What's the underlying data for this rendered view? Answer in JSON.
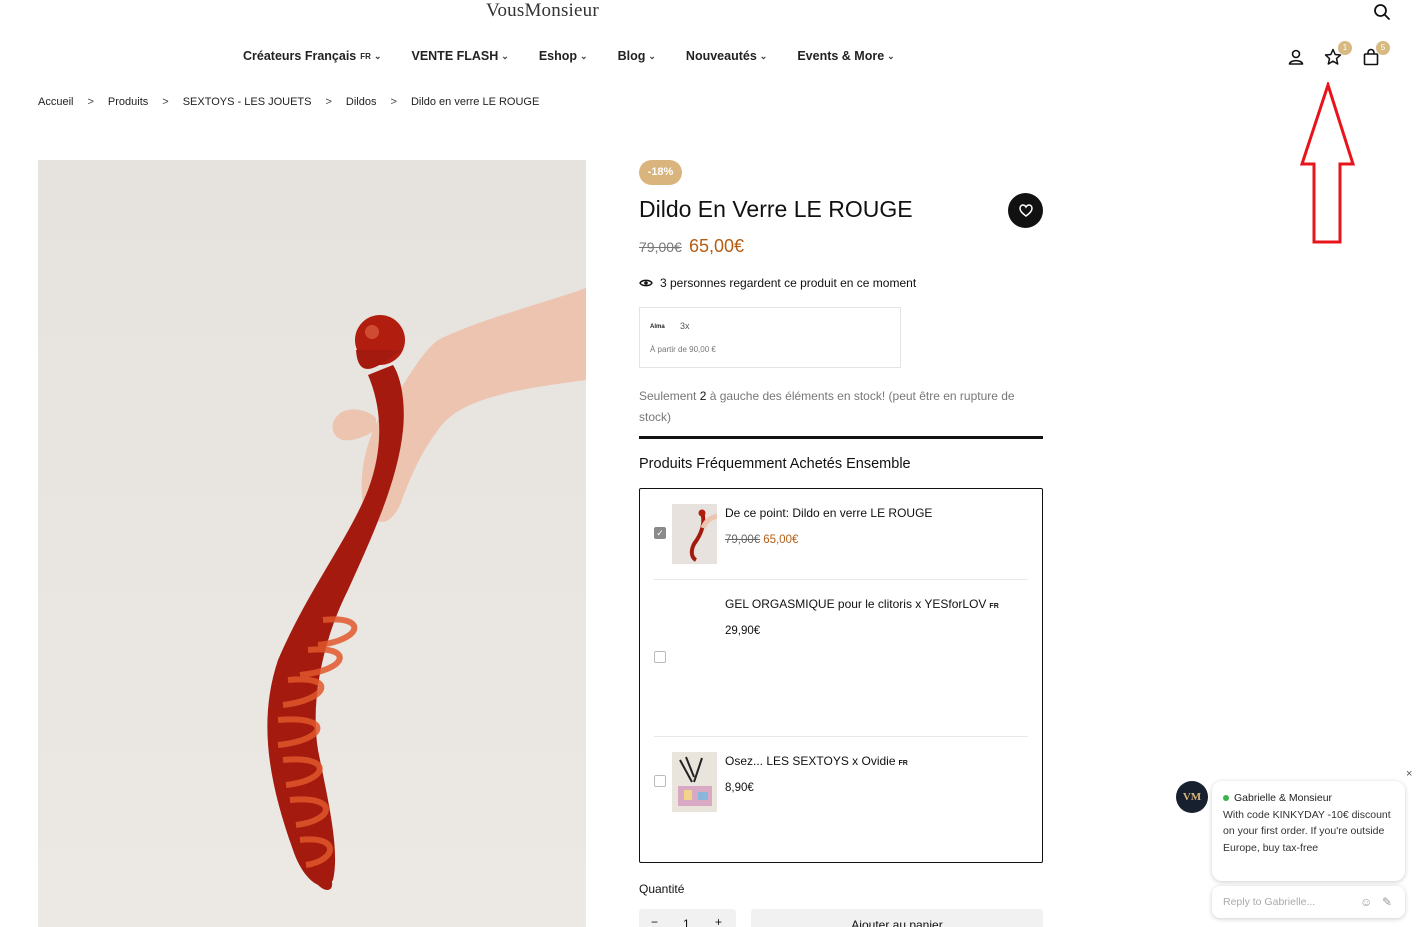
{
  "header": {
    "logo": "VousMonsieur",
    "nav": [
      {
        "label": "Créateurs Français",
        "tag": "FR"
      },
      {
        "label": "VENTE FLASH",
        "tag": ""
      },
      {
        "label": "Eshop",
        "tag": ""
      },
      {
        "label": "Blog",
        "tag": ""
      },
      {
        "label": "Nouveautés",
        "tag": ""
      },
      {
        "label": "Events & More",
        "tag": ""
      }
    ],
    "wishlist_count": "1",
    "cart_count": "5"
  },
  "breadcrumb": [
    "Accueil",
    "Produits",
    "SEXTOYS - LES JOUETS",
    "Dildos",
    "Dildo en verre LE ROUGE"
  ],
  "breadcrumb_sep": ">",
  "product": {
    "discount": "-18%",
    "title": "Dildo En Verre LE ROUGE",
    "price_old": "79,00€",
    "price_new": "65,00€",
    "watchers": "3 personnes regardent ce produit en ce moment",
    "alma": {
      "logo": "Alma",
      "option": "3x",
      "sub": "À partir de 90,00 €"
    },
    "stock_prefix": "Seulement",
    "stock_count": "2",
    "stock_suffix": "à gauche des éléments en stock! (peut être en rupture de stock)"
  },
  "fbt": {
    "title": "Produits Fréquemment Achetés Ensemble",
    "items": [
      {
        "name": "De ce point: Dildo en verre LE ROUGE",
        "tag": "",
        "price_old": "79,00€",
        "price": "65,00€",
        "checked": true
      },
      {
        "name": "GEL ORGASMIQUE pour le clitoris x YESforLOV",
        "tag": "FR",
        "price_old": "",
        "price": "29,90€",
        "checked": false
      },
      {
        "name": "Osez... LES SEXTOYS x Ovidie",
        "tag": "FR",
        "price_old": "",
        "price": "8,90€",
        "checked": false
      }
    ]
  },
  "purchase": {
    "qty_label": "Quantité",
    "minus": "−",
    "qty": "1",
    "plus": "+",
    "add_to_cart": "Ajouter au panier"
  },
  "chat": {
    "close": "×",
    "avatar": "VM",
    "sender": "Gabrielle & Monsieur",
    "message": "With code KINKYDAY -10€ discount on your first order. If you're outside Europe, buy tax-free",
    "placeholder": "Reply to Gabrielle..."
  },
  "colors": {
    "accent_gold": "#d9b47c",
    "price": "#b65d14",
    "annotation_arrow": "#e8141b"
  }
}
